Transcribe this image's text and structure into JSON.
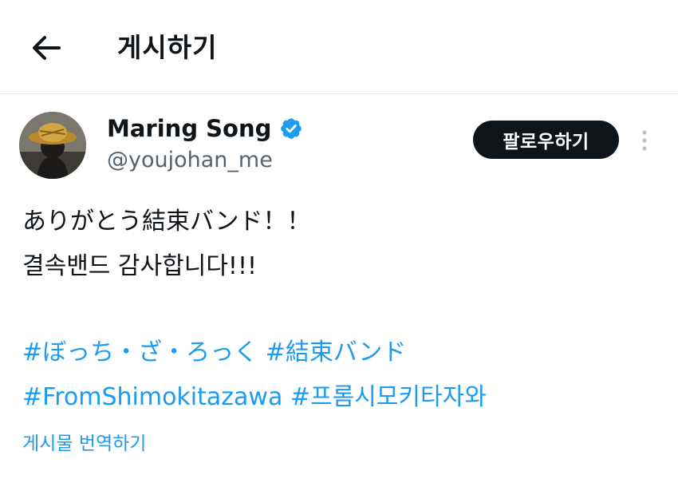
{
  "header": {
    "title": "게시하기",
    "back_icon": "arrow-left-icon"
  },
  "author": {
    "display_name": "Maring Song",
    "handle": "@youjohan_me",
    "verified": true,
    "verified_color": "#1d9bf0",
    "avatar_icon": "avatar-image"
  },
  "follow_button": {
    "label": "팔로우하기"
  },
  "more_icon": "more-vertical-icon",
  "post": {
    "lines": [
      "ありがとう結束バンド！！",
      "결속밴드 감사합니다!!!"
    ],
    "hashtag_rows": [
      [
        "#ぼっち・ざ・ろっく",
        "#結束バンド"
      ],
      [
        "#FromShimokitazawa",
        "#프롬시모키타자와"
      ]
    ]
  },
  "translate_link": "게시물 번역하기",
  "colors": {
    "accent": "#1d9bf0",
    "text_primary": "#0f1419",
    "text_secondary": "#536471",
    "button_bg": "#0f1419",
    "divider": "#e4e7ea"
  }
}
